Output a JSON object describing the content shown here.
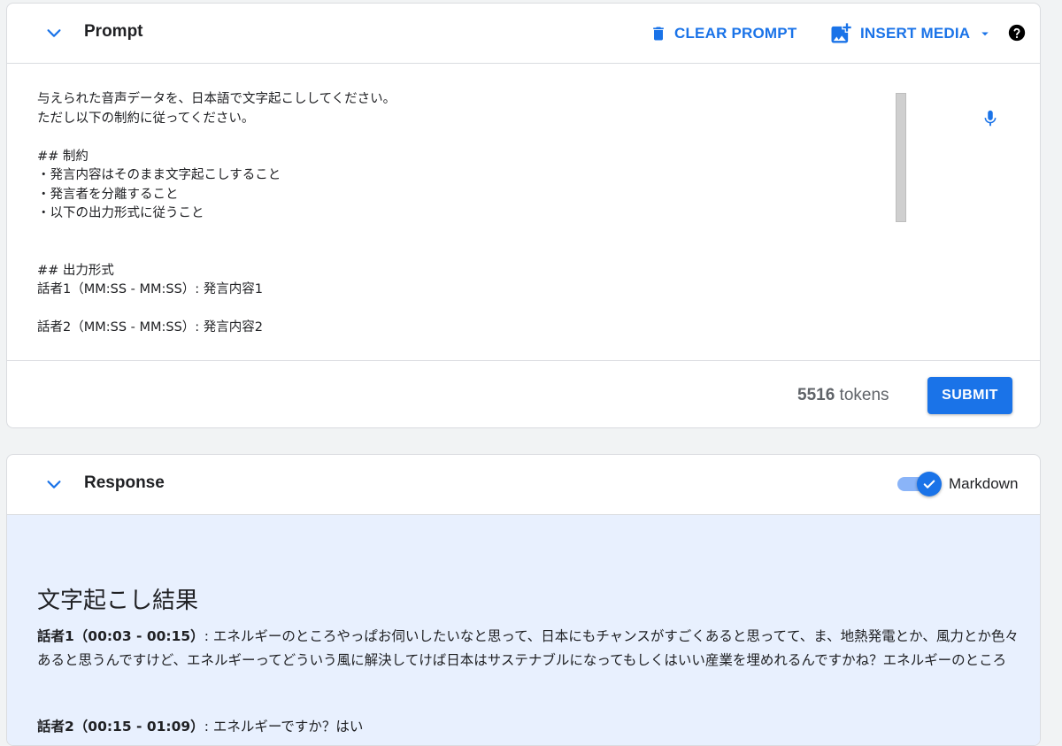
{
  "prompt": {
    "title": "Prompt",
    "clear_label": "CLEAR PROMPT",
    "insert_label": "INSERT MEDIA",
    "text": "与えられた音声データを、日本語で文字起こししてください。\nただし以下の制約に従ってください。\n\n## 制約\n・発言内容はそのまま文字起こしすること\n・発言者を分離すること\n・以下の出力形式に従うこと\n\n\n## 出力形式\n話者1（MM:SS - MM:SS）: 発言内容1\n\n話者2（MM:SS - MM:SS）: 発言内容2",
    "token_count": "5516",
    "token_suffix": " tokens",
    "submit_label": "SUBMIT"
  },
  "response": {
    "title": "Response",
    "markdown_label": "Markdown",
    "markdown_enabled": true,
    "heading": "文字起こし結果",
    "entries": [
      {
        "speaker": "話者1（00:03 - 00:15）",
        "text": ": エネルギーのところやっぱお伺いしたいなと思って、日本にもチャンスがすごくあると思ってて、ま、地熱発電とか、風力とか色々あると思うんですけど、エネルギーってどういう風に解決してけば日本はサステナブルになってもしくはいい産業を埋めれるんですかね？エネルギーのところ"
      },
      {
        "speaker": "話者2（00:15 - 01:09）",
        "text": ": エネルギーですか？はい"
      }
    ]
  },
  "colors": {
    "accent": "#1a73e8",
    "response_bg": "#e8f0fe",
    "toggle_track": "#8ab4f8"
  },
  "icons": {
    "collapse": "chevron-down-icon",
    "clear": "trash-icon",
    "insert": "add-photo-icon",
    "dropdown": "caret-down-icon",
    "help": "help-icon",
    "mic": "mic-icon",
    "check": "check-icon"
  }
}
